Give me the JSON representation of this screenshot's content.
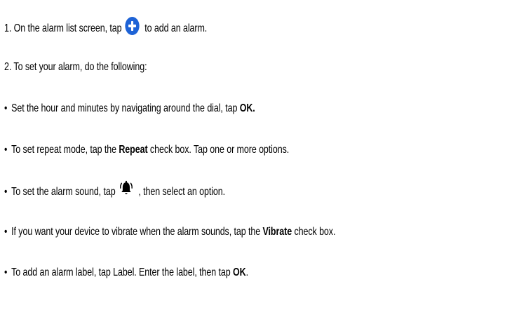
{
  "steps": {
    "step1": {
      "number": "1.",
      "text_before": "On the alarm list screen, tap",
      "icon": "add-circle-icon",
      "text_after": "to add an alarm."
    },
    "step2": {
      "number": "2.",
      "text": "To set your alarm, do the following:"
    }
  },
  "bullet_symbol": "•",
  "bullets": [
    {
      "before": "Set the hour and minutes by navigating around the dial, tap",
      "bold": "OK."
    },
    {
      "before": "To set repeat mode, tap the",
      "bold": "Repeat",
      "after": "check box. Tap one or more options."
    },
    {
      "before": "To set the alarm sound, tap",
      "icon": "alarm-bell-icon",
      "after": ", then select an option."
    },
    {
      "before": "If you want your device to vibrate when the alarm sounds, tap the",
      "bold": "Vibrate",
      "after": "check box."
    },
    {
      "before": "To add an alarm label, tap Label. Enter the label, then tap",
      "bold": "OK",
      "after": "."
    }
  ],
  "colors": {
    "text": "#000000",
    "accent_blue": "#1e63d6"
  }
}
